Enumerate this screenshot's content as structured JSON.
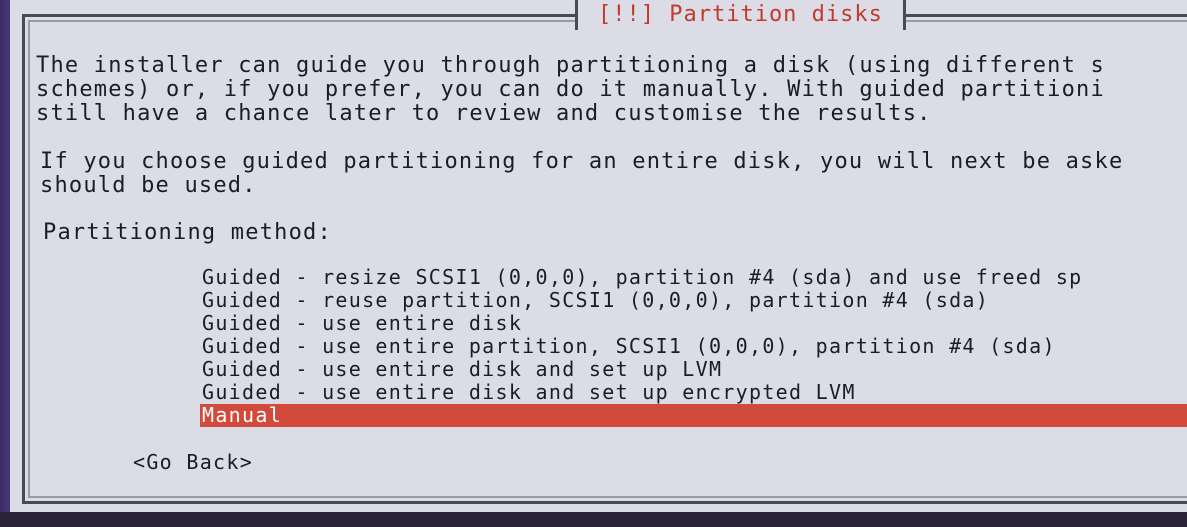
{
  "dialog": {
    "title": "[!!] Partition disks",
    "paragraph1": [
      "The installer can guide you through partitioning a disk (using different s",
      "schemes) or, if you prefer, you can do it manually. With guided partitioni",
      "still have a chance later to review and customise the results."
    ],
    "paragraph2": [
      "If you choose guided partitioning for an entire disk, you will next be aske",
      "should be used."
    ],
    "method_label": "Partitioning method:",
    "options": [
      "Guided - resize SCSI1 (0,0,0), partition #4 (sda) and use freed sp",
      "Guided - reuse partition, SCSI1 (0,0,0), partition #4 (sda)",
      "Guided - use entire disk",
      "Guided - use entire partition, SCSI1 (0,0,0), partition #4 (sda)",
      "Guided - use entire disk and set up LVM",
      "Guided - use entire disk and set up encrypted LVM",
      "Manual"
    ],
    "selected_index": 6,
    "go_back_label": "<Go Back>"
  },
  "colors": {
    "background": "#4a3a78",
    "dialog_bg": "#dcdce6",
    "title_text": "#c23a2a",
    "selection": "#d14a3c"
  }
}
